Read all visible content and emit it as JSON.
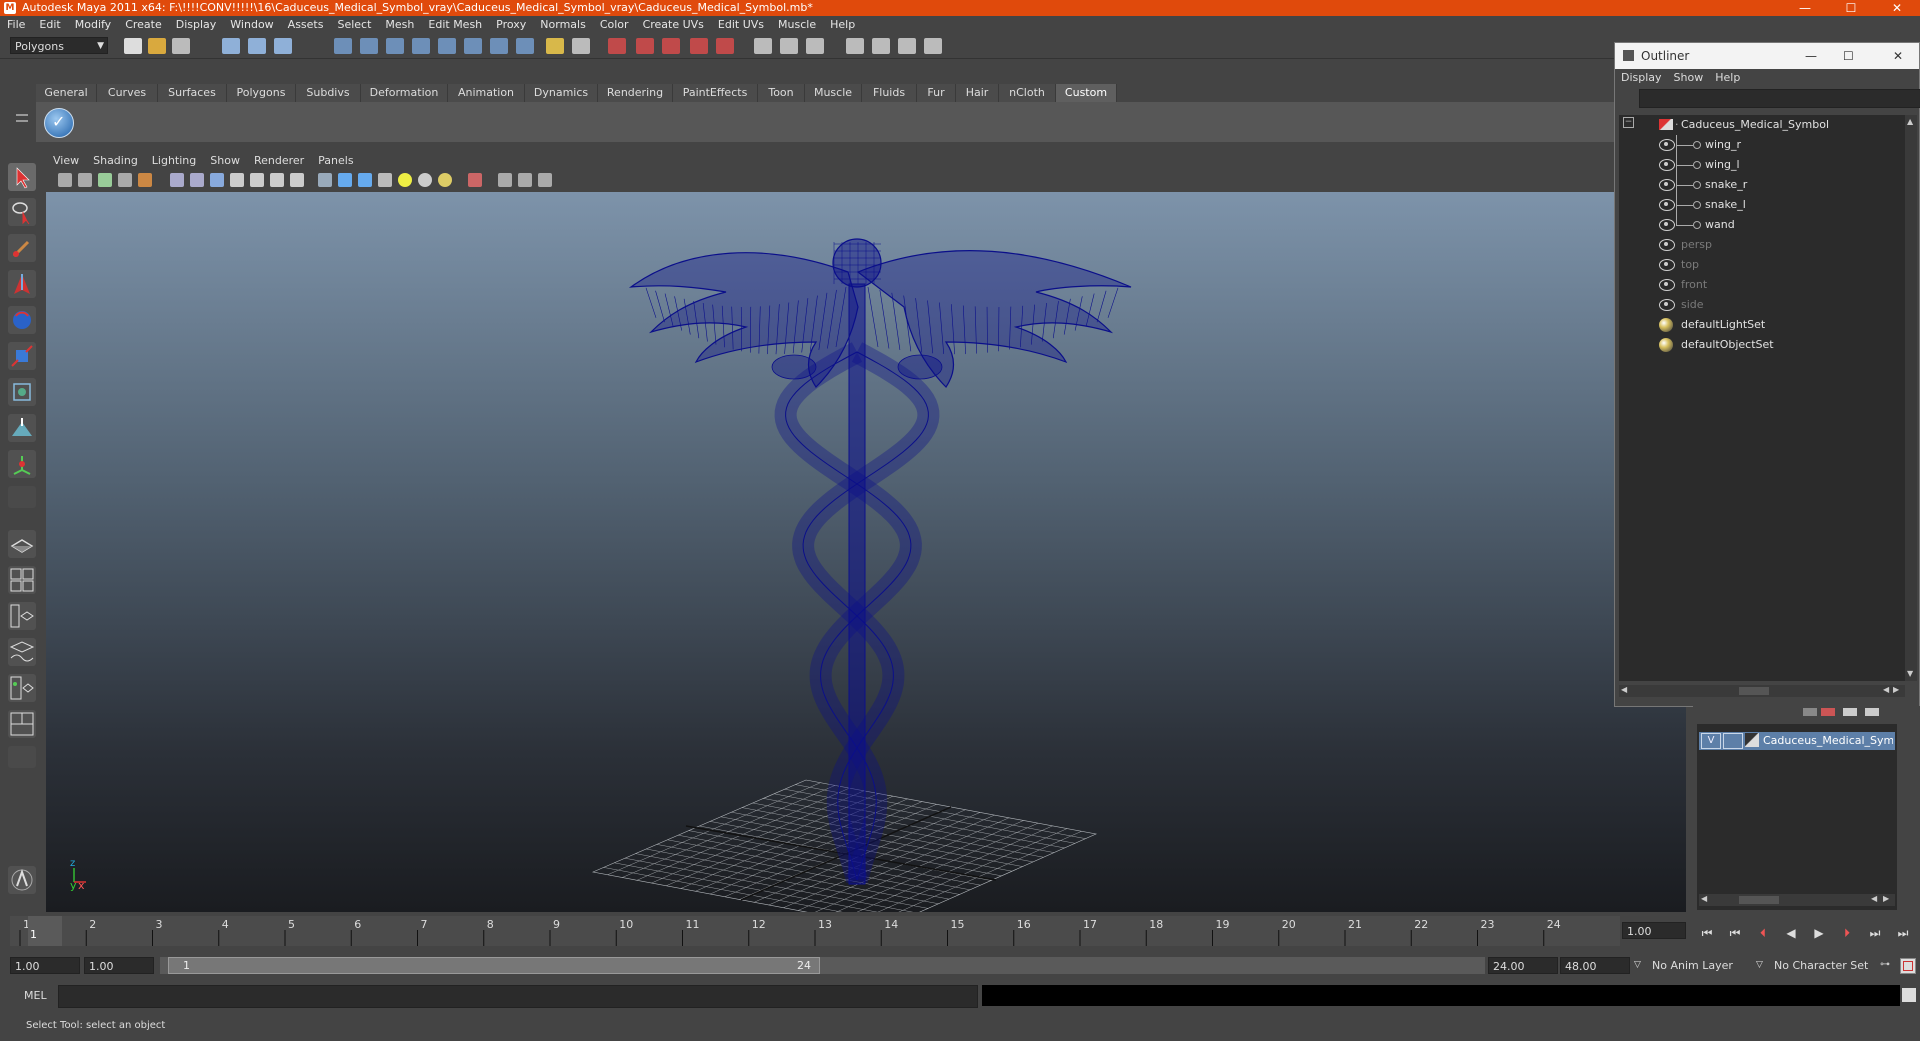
{
  "window": {
    "title": "Autodesk Maya 2011 x64: F:\\!!!!CONV!!!!!\\16\\Caduceus_Medical_Symbol_vray\\Caduceus_Medical_Symbol_vray\\Caduceus_Medical_Symbol.mb*",
    "controls": [
      "—",
      "☐",
      "✕"
    ]
  },
  "menubar": [
    "File",
    "Edit",
    "Modify",
    "Create",
    "Display",
    "Window",
    "Assets",
    "Select",
    "Mesh",
    "Edit Mesh",
    "Proxy",
    "Normals",
    "Color",
    "Create UVs",
    "Edit UVs",
    "Muscle",
    "Help"
  ],
  "toolbar": {
    "mode": "Polygons"
  },
  "shelf": {
    "tabs": [
      "General",
      "Curves",
      "Surfaces",
      "Polygons",
      "Subdivs",
      "Deformation",
      "Animation",
      "Dynamics",
      "Rendering",
      "PaintEffects",
      "Toon",
      "Muscle",
      "Fluids",
      "Fur",
      "Hair",
      "nCloth",
      "Custom"
    ],
    "active_tab": "Custom"
  },
  "viewport": {
    "menus": [
      "View",
      "Shading",
      "Lighting",
      "Show",
      "Renderer",
      "Panels"
    ],
    "axis_y": "y",
    "axis_x": "x",
    "axis_z": "z"
  },
  "outliner": {
    "title": "Outliner",
    "menus": [
      "Display",
      "Show",
      "Help"
    ],
    "items": [
      {
        "label": "Caduceus_Medical_Symbol",
        "type": "group",
        "dim": false
      },
      {
        "label": "wing_r",
        "type": "child",
        "dim": false
      },
      {
        "label": "wing_l",
        "type": "child",
        "dim": false
      },
      {
        "label": "snake_r",
        "type": "child",
        "dim": false
      },
      {
        "label": "snake_l",
        "type": "child",
        "dim": false
      },
      {
        "label": "wand",
        "type": "child",
        "dim": false
      },
      {
        "label": "persp",
        "type": "camera",
        "dim": true
      },
      {
        "label": "top",
        "type": "camera",
        "dim": true
      },
      {
        "label": "front",
        "type": "camera",
        "dim": true
      },
      {
        "label": "side",
        "type": "camera",
        "dim": true
      },
      {
        "label": "defaultLightSet",
        "type": "set",
        "dim": false
      },
      {
        "label": "defaultObjectSet",
        "type": "set",
        "dim": false
      }
    ]
  },
  "layers": {
    "visibility": "V",
    "layer_name": "Caduceus_Medical_Symb"
  },
  "timeline": {
    "ticks": [
      "1",
      "2",
      "3",
      "4",
      "5",
      "6",
      "7",
      "8",
      "9",
      "10",
      "11",
      "12",
      "13",
      "14",
      "15",
      "16",
      "17",
      "18",
      "19",
      "20",
      "21",
      "22",
      "23",
      "24"
    ],
    "current_frame": "1",
    "current_time_field": "1.00"
  },
  "range": {
    "start_time": "1.00",
    "playback_start": "1.00",
    "range_start": "1",
    "range_end": "24",
    "playback_end": "24.00",
    "end_time": "48.00",
    "anim_layer": "No Anim Layer",
    "character_set": "No Character Set"
  },
  "command": {
    "label": "MEL"
  },
  "help_line": "Select Tool: select an object",
  "colors": {
    "title_bar": "#e04a0c",
    "wireframe": "#0b0f8a",
    "active_tab": "#5f5f5f"
  }
}
